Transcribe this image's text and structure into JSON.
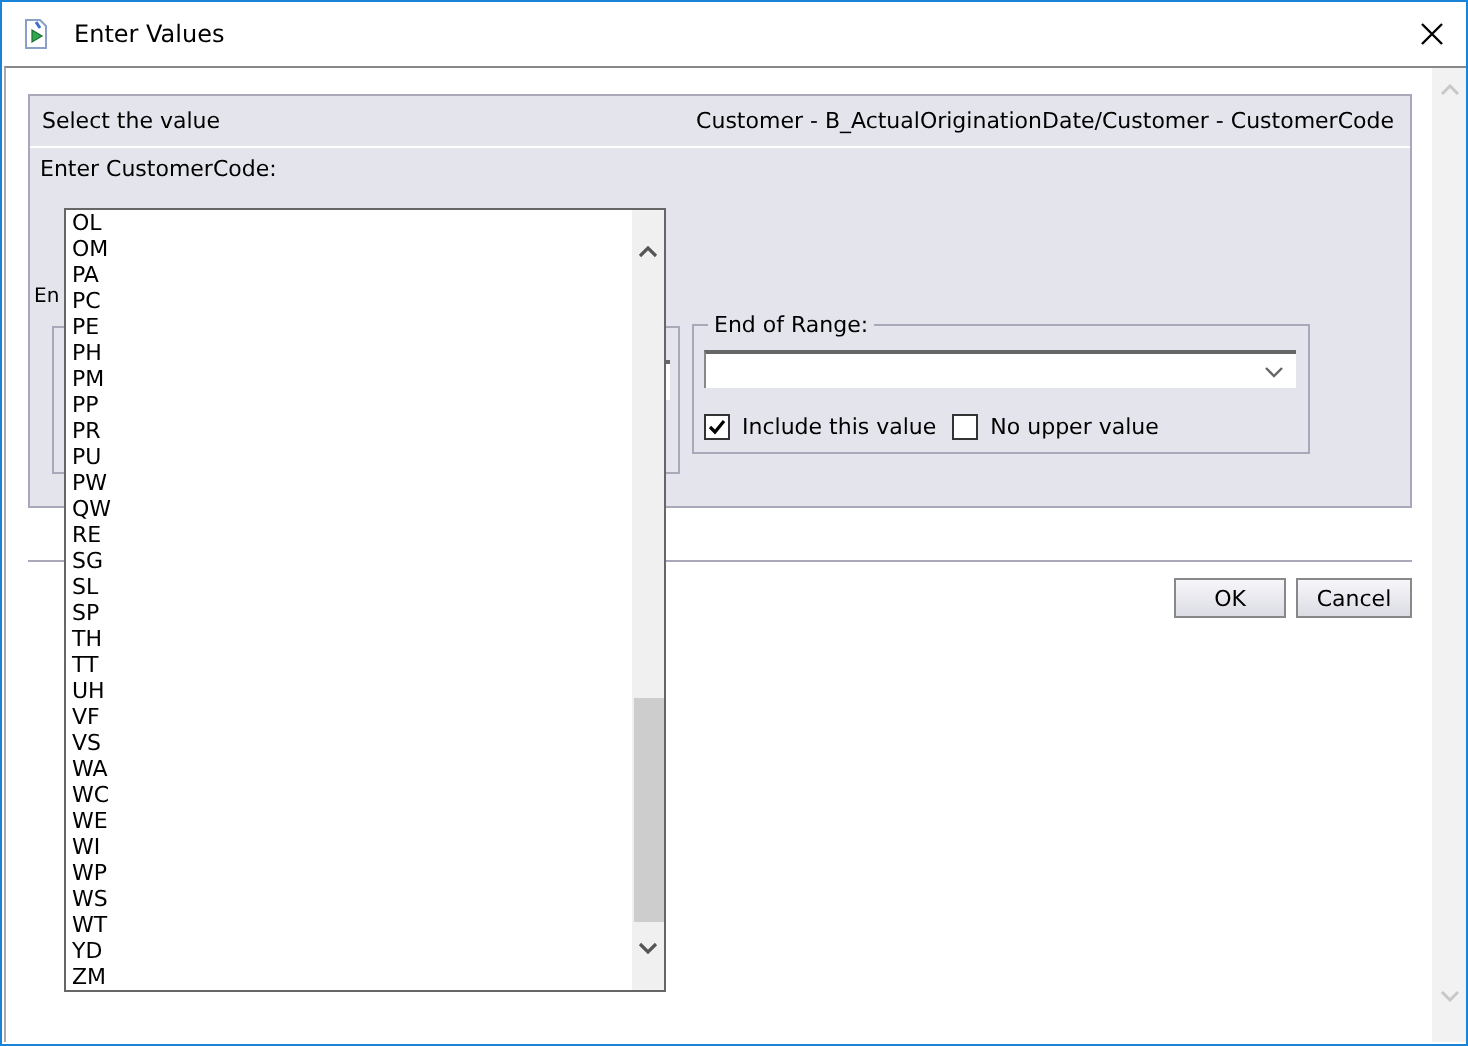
{
  "window": {
    "title": "Enter Values"
  },
  "panel": {
    "header_left": "Select the value",
    "header_right": "Customer - B_ActualOriginationDate/Customer - CustomerCode",
    "prompt": "Enter CustomerCode:",
    "hidden_label": "En"
  },
  "end_of_range": {
    "legend": "End of Range:",
    "options": [
      {
        "label": "Include this value",
        "checked": true
      },
      {
        "label": "No upper value",
        "checked": false
      }
    ]
  },
  "buttons": [
    "OK",
    "Cancel"
  ],
  "code_list": {
    "items": [
      "OL",
      "OM",
      "PA",
      "PC",
      "PE",
      "PH",
      "PM",
      "PP",
      "PR",
      "PU",
      "PW",
      "QW",
      "RE",
      "SG",
      "SL",
      "SP",
      "TH",
      "TT",
      "UH",
      "VF",
      "VS",
      "WA",
      "WC",
      "WE",
      "WI",
      "WP",
      "WS",
      "WT",
      "YD",
      "ZM"
    ]
  }
}
